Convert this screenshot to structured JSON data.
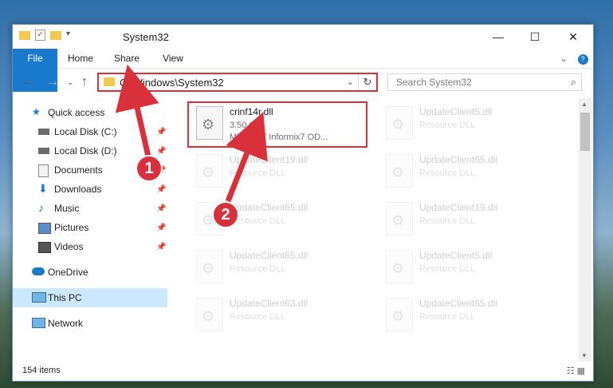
{
  "window": {
    "title": "System32",
    "controls": {
      "minimize": "—",
      "maximize": "☐",
      "close": "✕"
    }
  },
  "ribbon": {
    "tabs": [
      "File",
      "Home",
      "Share",
      "View"
    ]
  },
  "address": {
    "path": "C:\\Windows\\System32",
    "search_placeholder": "Search System32"
  },
  "nav": {
    "items": [
      {
        "label": "Quick access",
        "icon": "star-icon"
      },
      {
        "label": "Local Disk (C:)",
        "icon": "drive-icon"
      },
      {
        "label": "Local Disk (D:)",
        "icon": "drive-icon"
      },
      {
        "label": "Documents",
        "icon": "documents-icon"
      },
      {
        "label": "Downloads",
        "icon": "download-icon"
      },
      {
        "label": "Music",
        "icon": "music-icon"
      },
      {
        "label": "Pictures",
        "icon": "pictures-icon"
      },
      {
        "label": "Videos",
        "icon": "videos-icon"
      },
      {
        "label": "OneDrive",
        "icon": "cloud-icon"
      },
      {
        "label": "This PC",
        "icon": "computer-icon"
      },
      {
        "label": "Network",
        "icon": "network-icon"
      }
    ]
  },
  "files": [
    {
      "name": "crinf14r.dll",
      "version": "3.50.0.0",
      "desc": "MERANT Informix7 OD..."
    },
    {
      "name": "UpdateClient5.dll",
      "desc": "Resource DLL"
    },
    {
      "name": "UpdateClient19.dll",
      "desc": "Resource DLL"
    },
    {
      "name": "UpdateClient65.dll",
      "desc": "Resource DLL"
    },
    {
      "name": "UpdateClient65.dll",
      "desc": "Resource DLL"
    },
    {
      "name": "UpdateClient19.dll",
      "desc": "Resource DLL"
    },
    {
      "name": "UpdateClient65.dll",
      "desc": "Resource DLL"
    },
    {
      "name": "UpdateClient5.dll",
      "desc": "Resource DLL"
    },
    {
      "name": "UpdateClient63.dll",
      "desc": "Resource DLL"
    },
    {
      "name": "UpdateClient65.dll",
      "desc": "Resource DLL"
    }
  ],
  "status": {
    "count": "154 items"
  },
  "annotations": {
    "badge1": "1",
    "badge2": "2"
  },
  "colors": {
    "accent": "#1979ca",
    "highlight": "#d9313b",
    "selected": "#cce8ff"
  }
}
